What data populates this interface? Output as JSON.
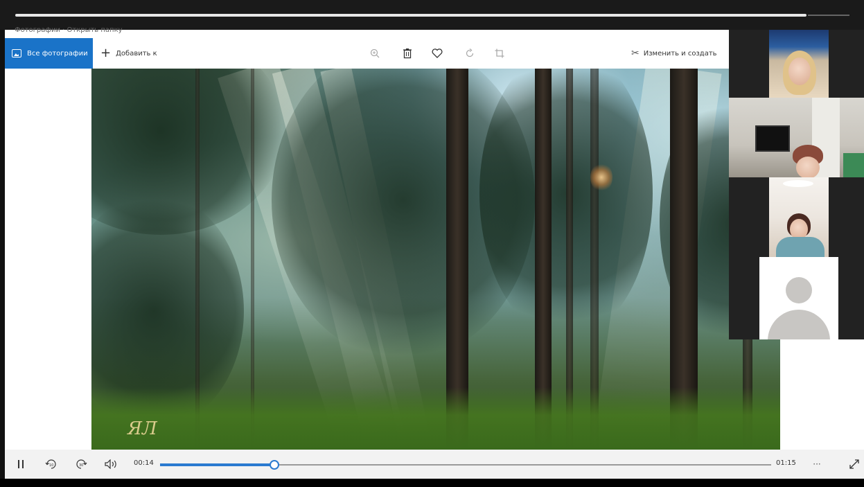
{
  "app": {
    "breadcrumb": "Фотографии  ·  Открыть папку",
    "toolbar": {
      "all_photos_label": "Все фотографии",
      "add_to_label": "Добавить к",
      "edit_create_label": "Изменить и создать",
      "tools": [
        "zoom-icon",
        "delete-icon",
        "favorite-icon",
        "rotate-icon",
        "crop-icon"
      ]
    },
    "media": {
      "watermark": "ЯЛ"
    }
  },
  "player": {
    "current_time": "00:14",
    "total_time": "01:15",
    "progress_fraction": 0.187,
    "more_label": "···",
    "skip_back_label": "10",
    "skip_forward_label": "30"
  },
  "participants": {
    "count": 4
  },
  "colors": {
    "accent": "#1a73c8",
    "seek_accent": "#2a7ad0"
  }
}
